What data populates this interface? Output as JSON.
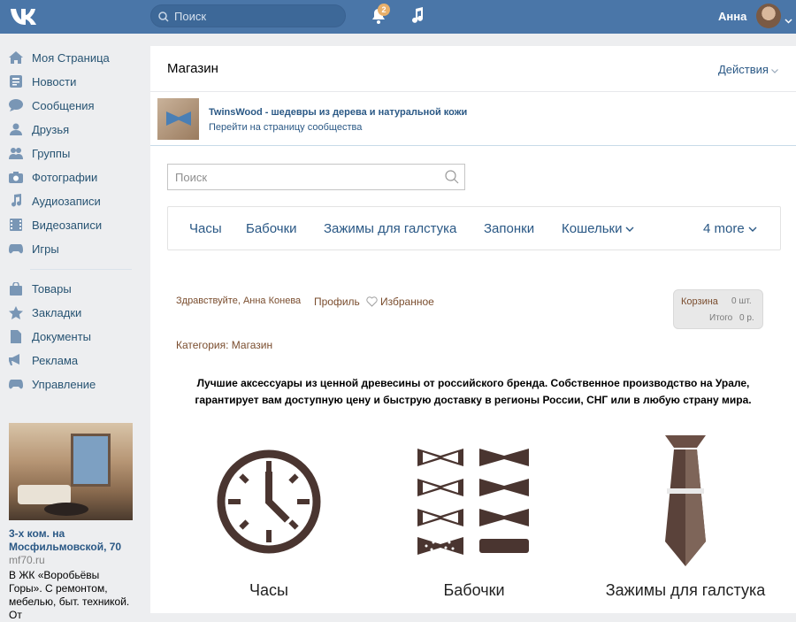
{
  "topbar": {
    "search_placeholder": "Поиск",
    "notifications_count": "2",
    "user_name": "Анна"
  },
  "sidebar": {
    "items": [
      {
        "label": "Моя Страница",
        "icon": "home-icon"
      },
      {
        "label": "Новости",
        "icon": "news-icon"
      },
      {
        "label": "Сообщения",
        "icon": "messages-icon"
      },
      {
        "label": "Друзья",
        "icon": "friends-icon"
      },
      {
        "label": "Группы",
        "icon": "groups-icon"
      },
      {
        "label": "Фотографии",
        "icon": "camera-icon"
      },
      {
        "label": "Аудиозаписи",
        "icon": "music-icon"
      },
      {
        "label": "Видеозаписи",
        "icon": "video-icon"
      },
      {
        "label": "Игры",
        "icon": "gamepad-icon"
      }
    ],
    "items2": [
      {
        "label": "Товары",
        "icon": "bag-icon"
      },
      {
        "label": "Закладки",
        "icon": "star-icon"
      },
      {
        "label": "Документы",
        "icon": "document-icon"
      },
      {
        "label": "Реклама",
        "icon": "megaphone-icon"
      },
      {
        "label": "Управление",
        "icon": "gamepad-icon"
      }
    ],
    "ad": {
      "title": "3-х ком. на Мосфильмовской, 70",
      "domain": "mf70.ru",
      "text": "В ЖК «Воробьёвы Горы». С ремонтом, мебелью, быт. техникой. От"
    }
  },
  "main": {
    "title": "Магазин",
    "actions_label": "Действия",
    "community": {
      "name": "TwinsWood - шедевры из дерева и натуральной кожи",
      "link": "Перейти на страницу сообщества"
    },
    "search_placeholder": "Поиск",
    "categories": [
      "Часы",
      "Бабочки",
      "Зажимы для галстука",
      "Запонки",
      "Кошельки"
    ],
    "more_label": "4 more",
    "greeting": "Здравствуйте, Анна Конева",
    "profile_label": "Профиль",
    "favorites_label": "Избранное",
    "cart": {
      "label": "Корзина",
      "count": "0 шт.",
      "total_label": "Итого",
      "total_value": "0 р."
    },
    "category_prefix": "Категория:",
    "category_name": "Магазин",
    "description": "Лучшие аксессуары из ценной древесины от российского бренда. Собственное производство на Урале, гарантирует вам доступную цену и быструю доставку в регионы России, СНГ или в любую страну мира.",
    "products": [
      {
        "label": "Часы",
        "icon": "clock-icon"
      },
      {
        "label": "Бабочки",
        "icon": "bowties-icon"
      },
      {
        "label": "Зажимы для галстука",
        "icon": "tie-icon"
      }
    ]
  },
  "colors": {
    "topbar": "#4a76a8",
    "link": "#2a5885",
    "brown": "#7a4d2e",
    "product_dark": "#4a3530"
  }
}
